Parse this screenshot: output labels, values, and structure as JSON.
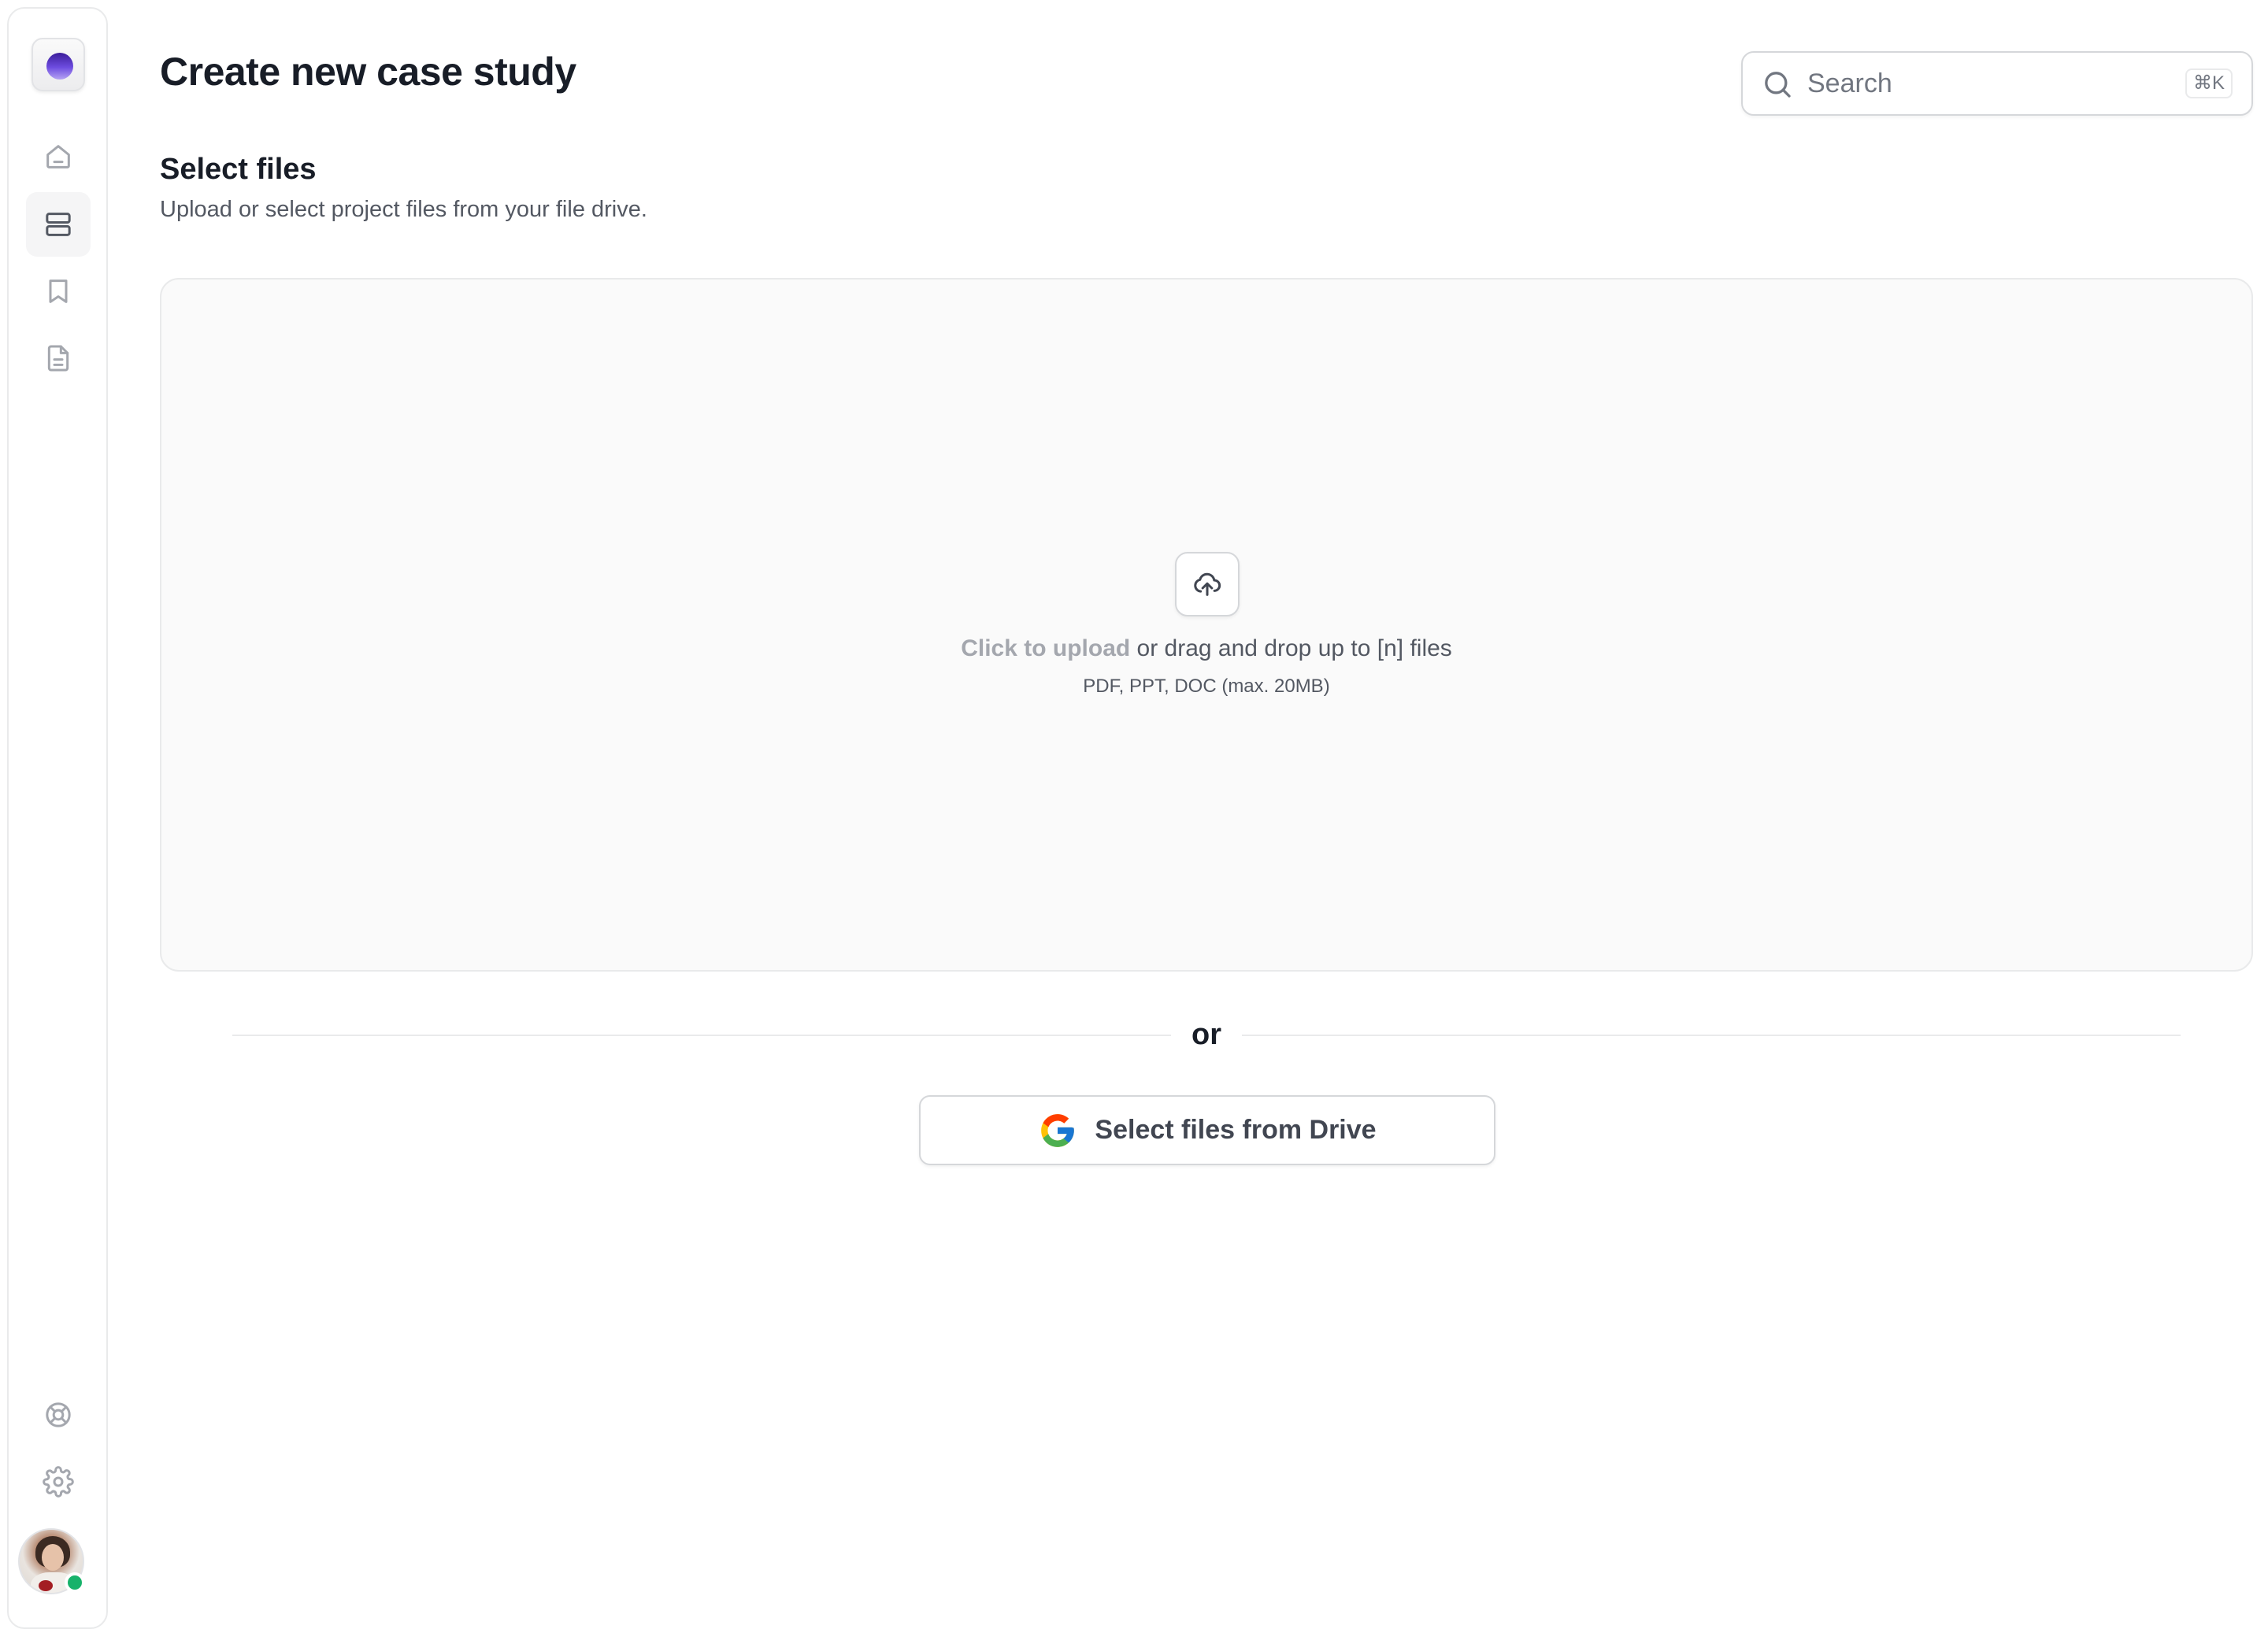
{
  "header": {
    "title": "Create new case study"
  },
  "search": {
    "placeholder": "Search",
    "value": "",
    "shortcut": "⌘K"
  },
  "sidebar": {
    "items": [
      {
        "name": "home",
        "icon": "home-icon",
        "active": false
      },
      {
        "name": "projects",
        "icon": "layers-icon",
        "active": true
      },
      {
        "name": "saved",
        "icon": "bookmark-icon",
        "active": false
      },
      {
        "name": "documents",
        "icon": "file-text-icon",
        "active": false
      }
    ],
    "footer_items": [
      {
        "name": "support",
        "icon": "life-buoy-icon"
      },
      {
        "name": "settings",
        "icon": "gear-icon"
      }
    ],
    "user_status": "online"
  },
  "section": {
    "title": "Select files",
    "description": "Upload or select project files from your file drive."
  },
  "dropzone": {
    "link_label": "Click to upload",
    "text": " or drag and drop up to [n] files",
    "hint": "PDF, PPT, DOC (max. 20MB)"
  },
  "divider": {
    "label": "or"
  },
  "drive_button": {
    "label": "Select files from Drive"
  },
  "colors": {
    "accent": "#6e4de0",
    "online": "#17b26a",
    "border": "#e9eaeb",
    "dropzone_bg": "#fafafa"
  }
}
